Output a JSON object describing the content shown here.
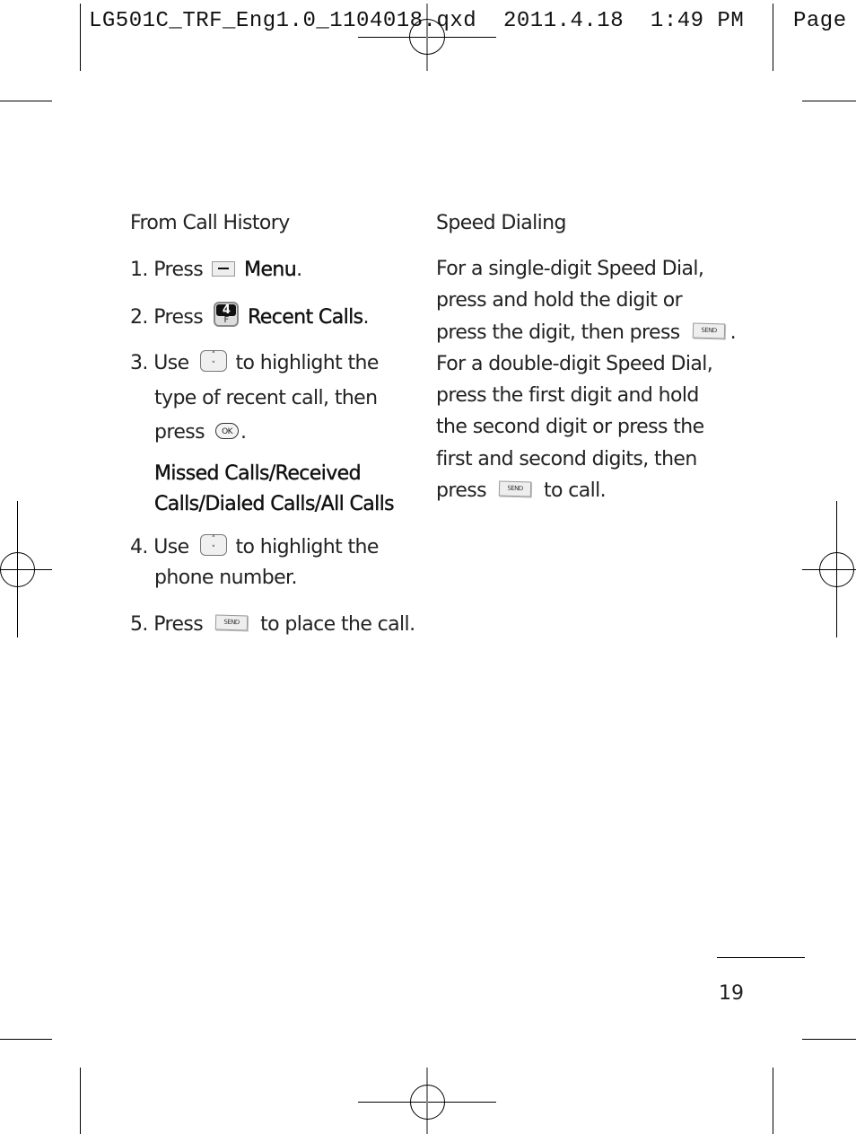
{
  "slug": {
    "filename": "LG501C_TRF_Eng1.0_1104018.qxd",
    "date": "2011.4.18",
    "time": "1:49 PM",
    "page_label": "Page"
  },
  "left_column": {
    "heading": "From Call History",
    "steps": [
      {
        "number": "1.",
        "pre": "Press",
        "icon": "menu-soft-key-icon",
        "post_bold": "Menu",
        "post": "."
      },
      {
        "number": "2.",
        "pre": "Press",
        "icon": "key-4-icon",
        "icon_top": "4",
        "icon_bottom": "F",
        "post_bold": "Recent Calls",
        "post": "."
      },
      {
        "number": "3.",
        "pre": "Use",
        "icon": "navigation-key-icon",
        "post": "to highlight the",
        "lines": [
          "type of recent call, then",
          "press"
        ],
        "icon2": "ok-key-icon",
        "icon2_label": "OK",
        "end": "."
      },
      {
        "number": "4.",
        "pre": "Use",
        "icon": "navigation-key-icon",
        "post": "to highlight the",
        "lines": [
          "phone number."
        ]
      },
      {
        "number": "5.",
        "pre": "Press",
        "icon": "send-key-icon",
        "icon_label": "SEND",
        "post": "to place the call."
      }
    ],
    "options_lines": [
      "Missed Calls/Received",
      "Calls/Dialed Calls/All Calls"
    ]
  },
  "right_column": {
    "heading": "Speed Dialing",
    "lines": [
      "For a single-digit Speed Dial,",
      "press and hold the digit or",
      "press the digit, then press",
      "For a double-digit Speed Dial,",
      "press the first digit and hold",
      "the second digit or press the",
      "first and second digits, then",
      "press",
      "to call."
    ],
    "send_label": "SEND",
    "period": "."
  },
  "page_number": "19",
  "nav_up": "˄",
  "nav_down": "˅"
}
